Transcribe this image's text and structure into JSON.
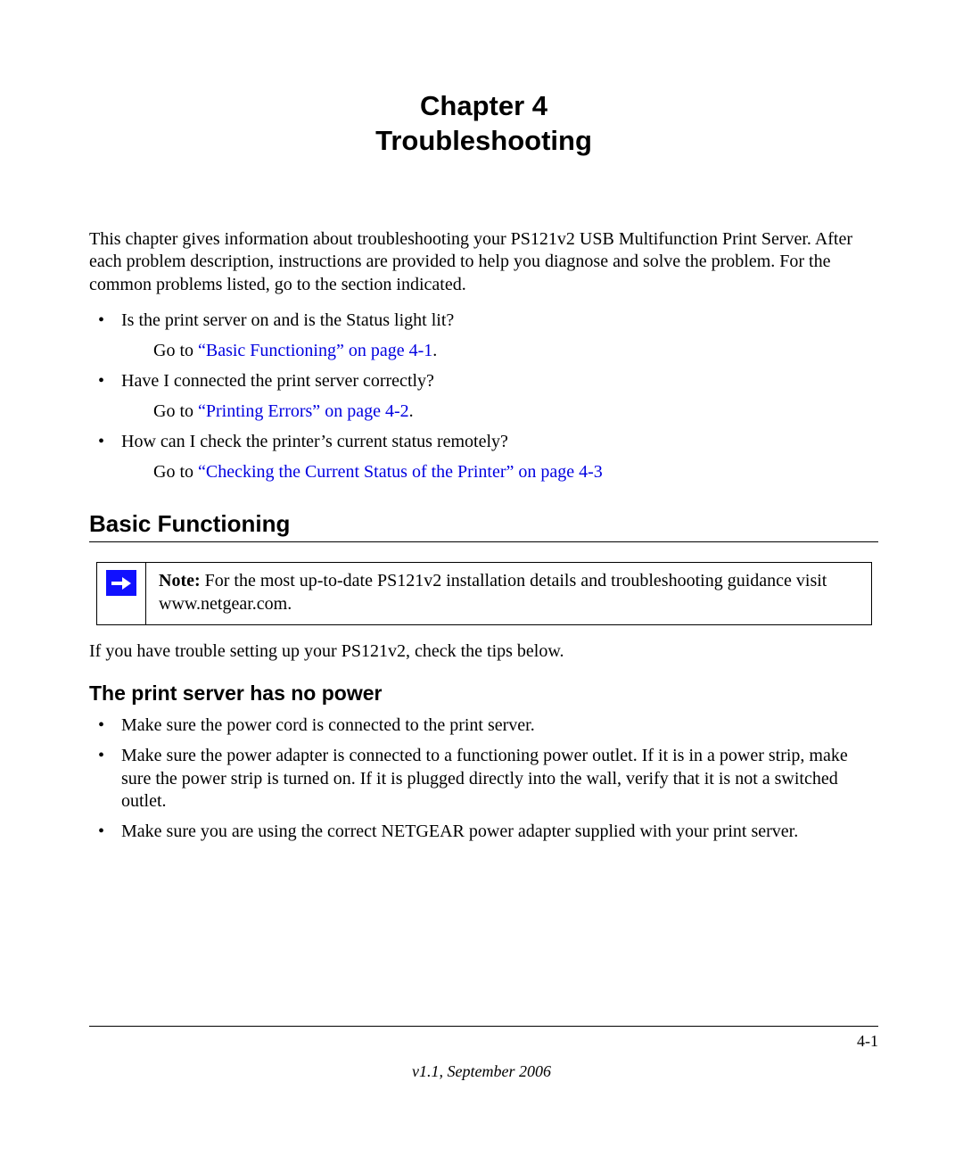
{
  "chapter": {
    "line1": "Chapter 4",
    "line2": "Troubleshooting"
  },
  "intro": "This chapter gives information about troubleshooting your  PS121v2 USB Multifunction Print Server. After each problem description, instructions are provided to help you diagnose and solve the problem. For the common problems listed, go to the section indicated.",
  "questions": [
    {
      "q": "Is the print server on and is the Status light lit?",
      "goto_prefix": "Go to ",
      "link": "“Basic Functioning” on page 4-1",
      "suffix": "."
    },
    {
      "q": "Have I connected the print server correctly?",
      "goto_prefix": "Go to ",
      "link": "“Printing Errors” on page 4-2",
      "suffix": "."
    },
    {
      "q": "How can I check the printer’s current status remotely?",
      "goto_prefix": "Go to ",
      "link": "“Checking the Current Status of the Printer” on page 4-3",
      "suffix": ""
    }
  ],
  "section1": {
    "heading": "Basic Functioning",
    "note_label": "Note: ",
    "note_body": "For the most up-to-date PS121v2 installation details and troubleshooting guidance visit www.netgear.com.",
    "after_note": "If you have trouble setting up your PS121v2, check the tips below."
  },
  "section2": {
    "heading": "The print server has no power",
    "bullets": [
      "Make sure the power cord is connected to the print server.",
      "Make sure the power adapter is connected to a functioning power outlet. If it is in a power strip, make sure the power strip is turned on. If it is plugged directly into the wall, verify that it is not a switched outlet.",
      "Make sure you are using the correct NETGEAR power adapter supplied with your print server."
    ]
  },
  "footer": {
    "page": "4-1",
    "version": "v1.1, September 2006"
  }
}
